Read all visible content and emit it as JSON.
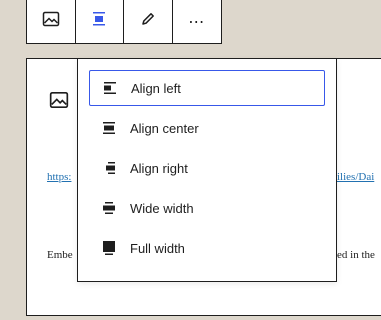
{
  "toolbar": {
    "buttons": [
      {
        "name": "image-icon"
      },
      {
        "name": "align-center-icon"
      },
      {
        "name": "pencil-icon"
      },
      {
        "name": "more-options-icon",
        "label": "⋯"
      }
    ]
  },
  "embed": {
    "url_left": "https:",
    "url_right": "ilies/Dai",
    "text_left": "Embe",
    "text_right": "ed in the"
  },
  "align_menu": {
    "options": [
      {
        "label": "Align left",
        "selected": true
      },
      {
        "label": "Align center",
        "selected": false
      },
      {
        "label": "Align right",
        "selected": false
      },
      {
        "label": "Wide width",
        "selected": false
      },
      {
        "label": "Full width",
        "selected": false
      }
    ]
  },
  "colors": {
    "accent": "#3858e9",
    "link": "#2271b1",
    "active_icon": "#3858e9",
    "background": "#ddd7cc"
  }
}
